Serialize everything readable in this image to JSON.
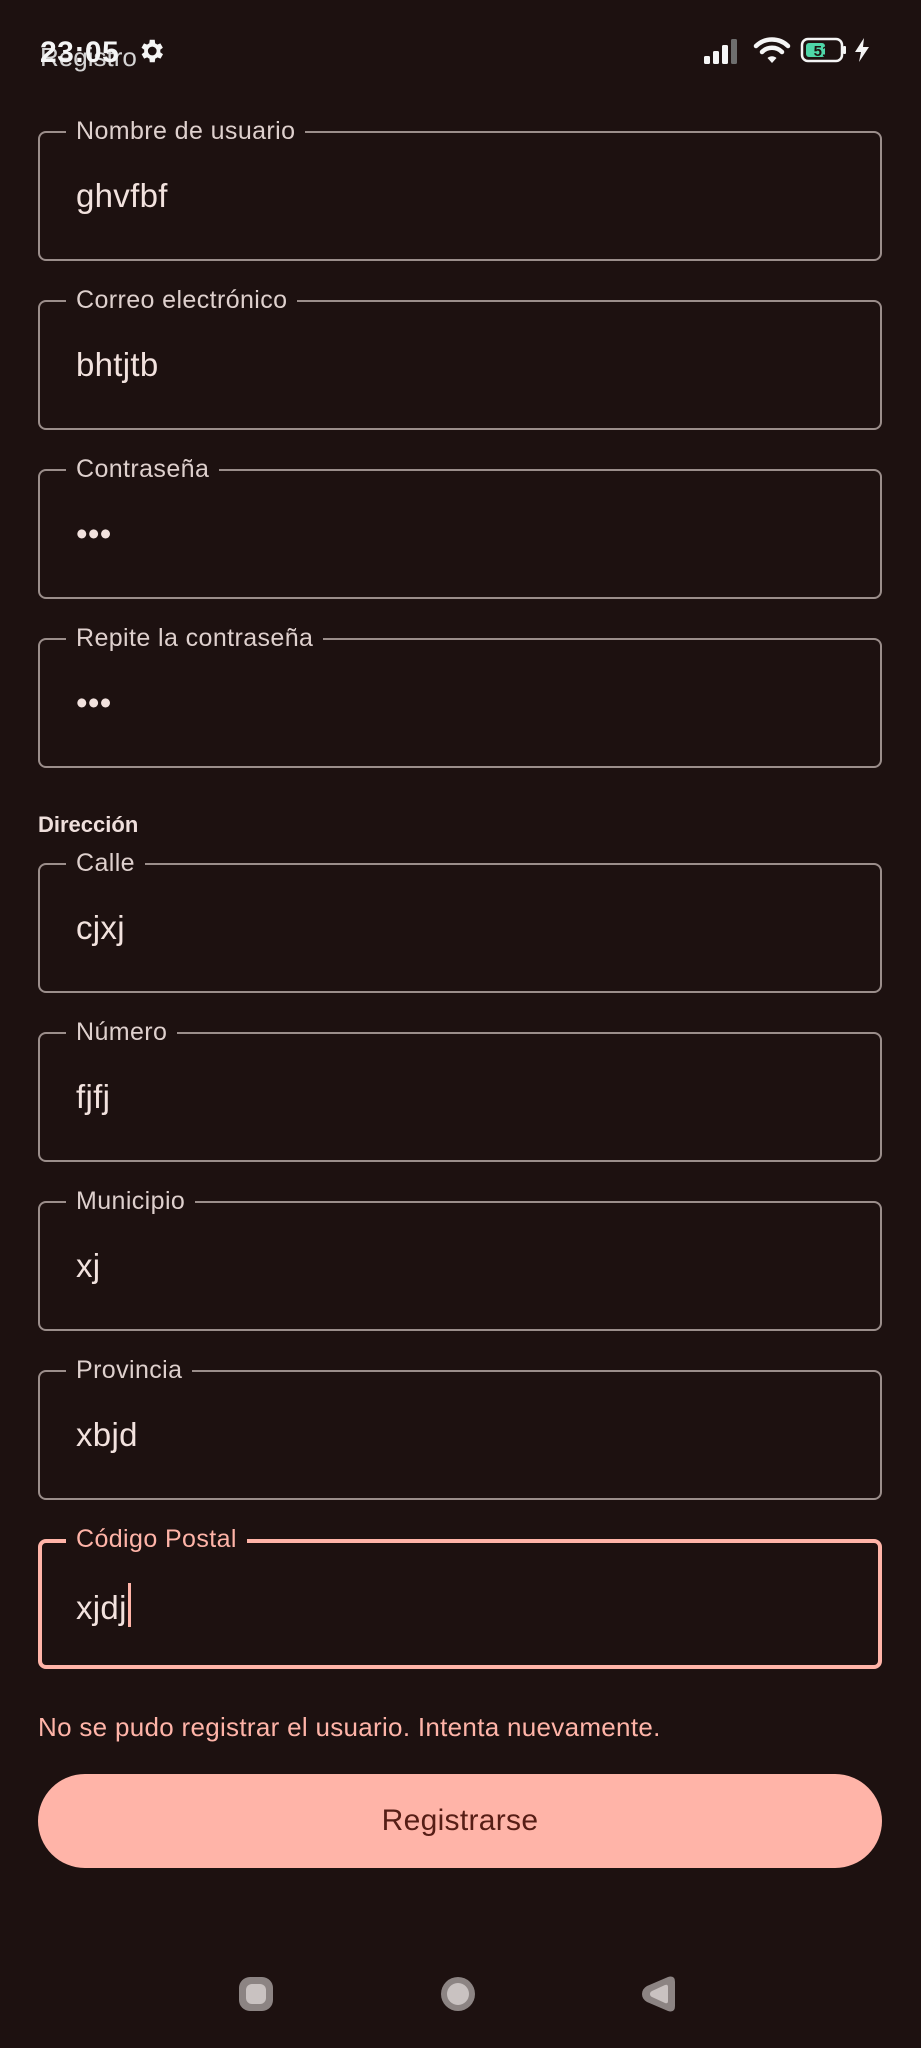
{
  "status_bar": {
    "time": "23:05",
    "title_overlap": "Registro",
    "battery_level": "51"
  },
  "form": {
    "username": {
      "label": "Nombre de usuario",
      "value": "ghvfbf"
    },
    "email": {
      "label": "Correo electrónico",
      "value": "bhtjtb"
    },
    "password": {
      "label": "Contraseña",
      "value": "•••"
    },
    "password_repeat": {
      "label": "Repite la contraseña",
      "value": "•••"
    },
    "address_heading": "Dirección",
    "street": {
      "label": "Calle",
      "value": "cjxj"
    },
    "number": {
      "label": "Número",
      "value": "fjfj"
    },
    "municipality": {
      "label": "Municipio",
      "value": "xj"
    },
    "province": {
      "label": "Provincia",
      "value": "xbjd"
    },
    "postal_code": {
      "label": "Código Postal",
      "value": "xjdj"
    },
    "error_message": "No se pudo registrar el usuario. Intenta nuevamente.",
    "submit_label": "Registrarse"
  },
  "nav_bar": {
    "icons": [
      "recents-icon",
      "home-icon",
      "back-icon"
    ]
  },
  "colors": {
    "background": "#1d1110",
    "accent": "#ffb4a8",
    "outline": "#9b8e8b",
    "button_text": "#561e16"
  }
}
